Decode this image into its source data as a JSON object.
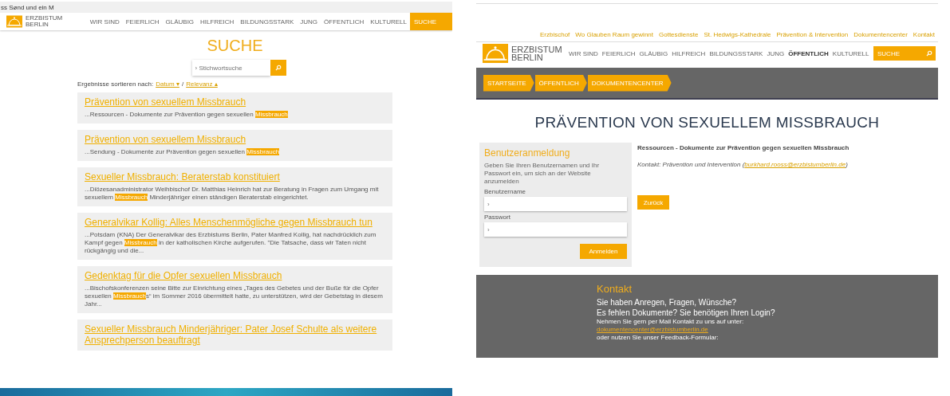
{
  "search_page": {
    "top_strip": "ss Sønd und ein M",
    "logo": {
      "line1": "ERZBISTUM",
      "line2": "BERLIN"
    },
    "nav": [
      {
        "label": "WIR SIND",
        "selected": false
      },
      {
        "label": "FEIERLICH",
        "selected": false
      },
      {
        "label": "GLÄUBIG",
        "selected": false
      },
      {
        "label": "HILFREICH",
        "selected": false
      },
      {
        "label": "BILDUNGSSTARK",
        "selected": false
      },
      {
        "label": "JUNG",
        "selected": false
      },
      {
        "label": "ÖFFENTLICH",
        "selected": false
      },
      {
        "label": "KULTURELL",
        "selected": false
      },
      {
        "label": "SUCHE",
        "selected": true
      }
    ],
    "title": "SUCHE",
    "search": {
      "placeholder": "› Stichwortsuche"
    },
    "sort": {
      "label": "Ergebnisse sortieren nach:",
      "options": [
        "Datum ▾",
        "Relevanz ▴"
      ],
      "separator": "/"
    },
    "results": [
      {
        "title": "Prävention von sexuellem Missbrauch",
        "snippet": {
          "before": "...Ressourcen - Dokumente zur Prävention gegen sexuellen ",
          "highlight": "Missbrauch"
        }
      },
      {
        "title": "Prävention von sexuellem Missbrauch",
        "snippet": {
          "before": "...Sendung - Dokumente zur Prävention gegen sexuellen ",
          "highlight": "Missbrauch"
        }
      },
      {
        "title": "Sexueller Missbrauch: Beraterstab konstituiert",
        "snippet": {
          "before": "...Diözesanadministrator Weihbischof Dr. Matthias Heinrich hat zur Beratung in Fragen zum Umgang mit sexuellem ",
          "highlight": "Missbrauch",
          "after": " Minderjähriger einen ständigen Beraterstab eingerichtet."
        }
      },
      {
        "title": "Generalvikar Kollig: Alles Menschenmögliche gegen Missbrauch tun",
        "snippet": {
          "before": "...Potsdam (KNA) Der Generalvikar des Erzbistums Berlin, Pater Manfred Kollig, hat nachdrücklich zum Kampf gegen ",
          "highlight": "Missbrauch",
          "after": " in der katholischen Kirche aufgerufen. \"Die Tatsache, dass wir Taten nicht rückgängig und die..."
        }
      },
      {
        "title": "Gedenktag für die Opfer sexuellen Missbrauch",
        "snippet": {
          "before": "...Bischofskonferenzen seine Bitte zur Einrichtung eines „Tages des Gebetes und der Buße für die Opfer sexuellen ",
          "highlight": "Missbrauch",
          "after": "s“ im Sommer 2016 übermittelt hatte, zu unterstützen, wird der Gebetstag in diesem Jahr..."
        }
      },
      {
        "title": "Sexueller Missbrauch Minderjähriger: Pater Josef Schulte als weitere Ansprechperson beauftragt"
      }
    ]
  },
  "document_page": {
    "top_links": [
      "Erzbischof",
      "Wo Glauben Raum gewinnt",
      "Gottesdienste",
      "St. Hedwigs-Kathedrale",
      "Prävention & Intervention",
      "Dokumentencenter",
      "Kontakt"
    ],
    "logo": {
      "line1": "ERZBISTUM",
      "line2": "BERLIN"
    },
    "nav": [
      {
        "label": "WIR SIND",
        "selected": false
      },
      {
        "label": "FEIERLICH",
        "selected": false
      },
      {
        "label": "GLÄUBIG",
        "selected": false
      },
      {
        "label": "HILFREICH",
        "selected": false
      },
      {
        "label": "BILDUNGSSTARK",
        "selected": false
      },
      {
        "label": "JUNG",
        "selected": false
      },
      {
        "label": "ÖFFENTLICH",
        "selected": true
      },
      {
        "label": "KULTURELL",
        "selected": false
      }
    ],
    "search": {
      "placeholder": "SUCHE"
    },
    "breadcrumbs": [
      "STARTSEITE",
      "ÖFFENTLICH",
      "DOKUMENTENCENTER"
    ],
    "title": "PRÄVENTION VON SEXUELLEM MISSBRAUCH",
    "login": {
      "title": "Benutzeranmeldung",
      "intro": "Geben Sie Ihren Benutzernamen und Ihr Passwort ein, um sich an der Website anzumelden",
      "fields": [
        {
          "label": "Benutzername",
          "placeholder": "›"
        },
        {
          "label": "Passwort",
          "placeholder": "›"
        }
      ],
      "button": "Anmelden"
    },
    "description": "Ressourcen - Dokumente zur Prävention gegen sexuellen Missbrauch",
    "contact_line": {
      "text": "Kontakt: Prävention und Intervention (",
      "link": "burkhard.rooss@erzbistumberlin.de",
      "end": ")"
    },
    "back_button": "Zurück",
    "footer": {
      "title": "Kontakt",
      "lines": [
        "Sie haben Anregen, Fragen, Wünsche?",
        "Es fehlen Dokumente? Sie benötigen Ihren Login?"
      ],
      "text": "Nehmen Sie gern per Mail Kontakt zu uns auf unter:",
      "link": "dokumentencenter@erzbistumberlin.de",
      "text2": "oder nutzen Sie unser Feedback-Formular:"
    }
  }
}
